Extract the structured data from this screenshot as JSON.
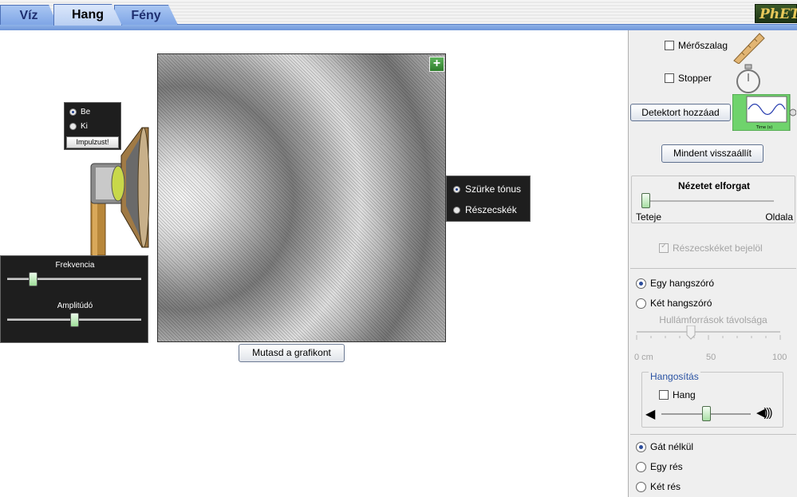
{
  "tabs": [
    {
      "label": "Víz",
      "active": false
    },
    {
      "label": "Hang",
      "active": true
    },
    {
      "label": "Fény",
      "active": false
    }
  ],
  "logo": "PhET",
  "source_panel": {
    "on_label": "Be",
    "off_label": "Ki",
    "selected": "Be",
    "pulse_button": "Impulzust!"
  },
  "wave_controls": {
    "frequency_label": "Frekvencia",
    "frequency_level": 0.17,
    "amplitude_label": "Amplitúdó",
    "amplitude_level": 0.5
  },
  "view_options": {
    "grayscale_label": "Szürke tónus",
    "particles_label": "Részecskék",
    "selected": "Szürke tónus"
  },
  "show_graph_button": "Mutasd a grafikont",
  "right_panel": {
    "measuring_tape_label": "Mérőszalag",
    "stopwatch_label": "Stopper",
    "add_detector_button": "Detektort hozzáad",
    "reset_all_button": "Mindent visszaállít",
    "rotate_view": {
      "title": "Nézetet elforgat",
      "left_label": "Teteje",
      "right_label": "Oldala",
      "level": 0.0
    },
    "mark_particles_label": "Részecskéket bejelöl",
    "one_speaker_label": "Egy hangszóró",
    "two_speakers_label": "Két hangszóró",
    "source_selected": "Egy hangszóró",
    "separation": {
      "title": "Hullámforrások távolsága",
      "tick_labels": [
        "0 cm",
        "50",
        "100"
      ],
      "level": 0.5
    },
    "sound": {
      "title": "Hangosítás",
      "checkbox_label": "Hang",
      "volume_level": 0.5
    },
    "barrier_none_label": "Gát nélkül",
    "one_slit_label": "Egy rés",
    "two_slits_label": "Két rés",
    "barrier_selected": "Gát nélkül"
  },
  "detector_chart_axis": "Time (s)"
}
